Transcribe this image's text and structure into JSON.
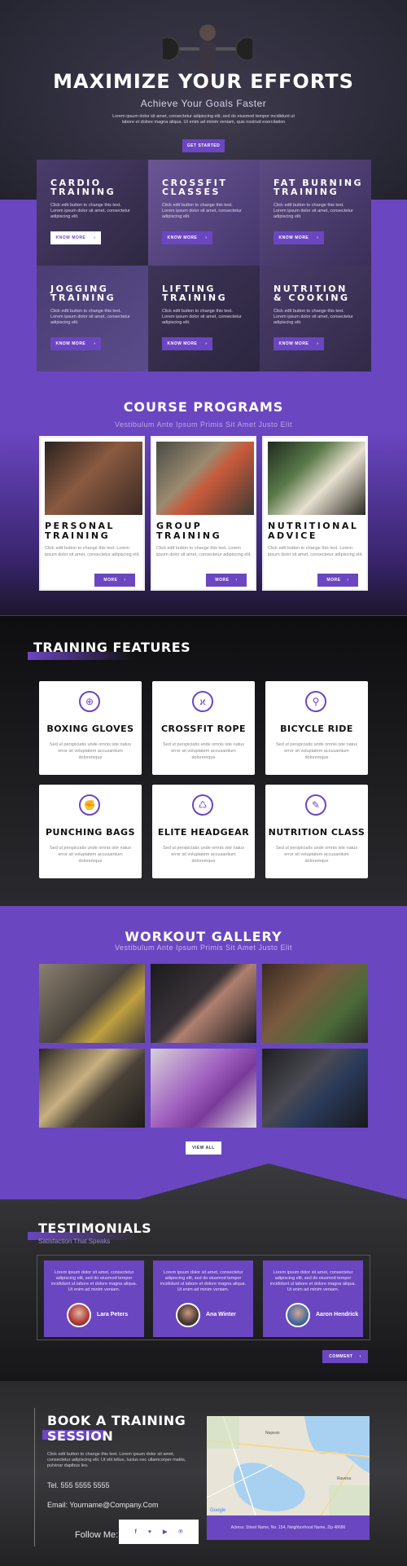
{
  "hero": {
    "title": "MAXIMIZE YOUR EFFORTS",
    "subtitle": "Achieve Your Goals Faster",
    "text": "Lorem ipsum dolor sit amet, consectetur adipiscing elit, sed do eiusmod tempor incididunt ut labore et dolore magna aliqua. Ut enim ad minim veniam, quis nostrud exercitation",
    "button": "GET STARTED"
  },
  "services": [
    {
      "title1": "CARDIO",
      "title2": "TRAINING",
      "text": "Click edit button to change this text. Lorem ipsum dolor sit amet, consectetur adipiscing elit.",
      "button": "KNOW MORE",
      "button_style": "white"
    },
    {
      "title1": "CROSSFIT",
      "title2": "CLASSES",
      "text": "Click edit button to change this text. Lorem ipsum dolor sit amet, consectetur adipiscing elit.",
      "button": "KNOW MORE",
      "button_style": "purple"
    },
    {
      "title1": "FAT BURNING",
      "title2": "TRAINING",
      "text": "Click edit button to change this text. Lorem ipsum dolor sit amet, consectetur adipiscing elit.",
      "button": "KNOW MORE",
      "button_style": "purple"
    },
    {
      "title1": "JOGGING",
      "title2": "TRAINING",
      "text": "Click edit button to change this text. Lorem ipsum dolor sit amet, consectetur adipiscing elit.",
      "button": "KNOW MORE",
      "button_style": "purple"
    },
    {
      "title1": "LIFTING",
      "title2": "TRAINING",
      "text": "Click edit button to change this text. Lorem ipsum dolor sit amet, consectetur adipiscing elit.",
      "button": "KNOW MORE",
      "button_style": "purple"
    },
    {
      "title1": "NUTRITION",
      "title2": "& COOKING",
      "text": "Click edit button to change this text. Lorem ipsum dolor sit amet, consectetur adipiscing elit.",
      "button": "KNOW MORE",
      "button_style": "purple"
    }
  ],
  "programs": {
    "title": "COURSE PROGRAMS",
    "subtitle": "Vestibulum Ante Ipsum Primis Sit Amet Justo Elit",
    "items": [
      {
        "title1": "PERSONAL",
        "title2": "TRAINING",
        "text": "Click edit button to change this text. Lorem ipsum dolor sit amet, consectetur adipiscing elit.",
        "button": "MORE"
      },
      {
        "title1": "GROUP",
        "title2": "TRAINING",
        "text": "Click edit button to change this text. Lorem ipsum dolor sit amet, consectetur adipiscing elit.",
        "button": "MORE"
      },
      {
        "title1": "NUTRITIONAL",
        "title2": "ADVICE",
        "text": "Click edit button to change this text. Lorem ipsum dolor sit amet, consectetur adipiscing elit.",
        "button": "MORE"
      }
    ]
  },
  "features": {
    "title": "TRAINING FEATURES",
    "items": [
      {
        "title": "BOXING GLOVES",
        "icon": "boxing-glove-icon",
        "glyph": "⊕",
        "text": "Sed ut perspiciatis unde omnis iste natus error sit voluptatem accusantium doloremque"
      },
      {
        "title": "CROSSFIT ROPE",
        "icon": "rope-icon",
        "glyph": "ϰ",
        "text": "Sed ut perspiciatis unde omnis iste natus error sit voluptatem accusantium doloremque"
      },
      {
        "title": "BICYCLE RIDE",
        "icon": "bicycle-icon",
        "glyph": "⚲",
        "text": "Sed ut perspiciatis unde omnis iste natus error sit voluptatem accusantium doloremque"
      },
      {
        "title": "PUNCHING BAGS",
        "icon": "punching-bag-icon",
        "glyph": "✊",
        "text": "Sed ut perspiciatis unde omnis iste natus error sit voluptatem accusantium doloremque"
      },
      {
        "title": "ELITE HEADGEAR",
        "icon": "headgear-icon",
        "glyph": "♺",
        "text": "Sed ut perspiciatis unde omnis iste natus error sit voluptatem accusantium doloremque"
      },
      {
        "title": "NUTRITION CLASS",
        "icon": "nutrition-icon",
        "glyph": "✎",
        "text": "Sed ut perspiciatis unde omnis iste natus error sit voluptatem accusantium doloremque"
      }
    ]
  },
  "gallery": {
    "title": "WORKOUT GALLERY",
    "subtitle": "Vestibulum Ante Ipsum Primis Sit Amet Justo Elit",
    "button": "VIEW ALL"
  },
  "testimonials": {
    "title": "TESTIMONIALS",
    "subtitle": "Satisfaction That Speaks",
    "button": "COMMENT",
    "items": [
      {
        "text": "Lorem ipsum dolor sit amet, consectetur adipiscing elit, sed do eiusmod tempor incididunt ut labore et dolore magna aliqua. Ut enim ad minim veniam.",
        "name": "Lara Peters"
      },
      {
        "text": "Lorem ipsum dolor sit amet, consectetur adipiscing elit, sed do eiusmod tempor incididunt ut labore et dolore magna aliqua. Ut enim ad minim veniam.",
        "name": "Ana Winter"
      },
      {
        "text": "Lorem ipsum dolor sit amet, consectetur adipiscing elit, sed do eiusmod tempor incididunt ut labore et dolore magna aliqua. Ut enim ad minim veniam.",
        "name": "Aaron Hendrick"
      }
    ]
  },
  "booking": {
    "title1": "BOOK A TRAINING",
    "title2": "SESSION",
    "text": "Click edit button to change this text. Lorem ipsum dolor sit amet, consectetur adipiscing elit. Ut elit tellus, luctus nec ullamcorper mattis, pulvinar dapibus leo.",
    "tel": "Tel. 555 5555 5555",
    "email": "Email: Yourname@Company.Com",
    "follow": "Follow Me:",
    "address": "Adress: Street Name, No. 154, Neighborhood Name, Zip 48686",
    "map_labels": [
      "Google",
      "Nepean",
      "Ravena"
    ]
  },
  "colors": {
    "accent": "#6b46c1",
    "dark": "#111111"
  }
}
